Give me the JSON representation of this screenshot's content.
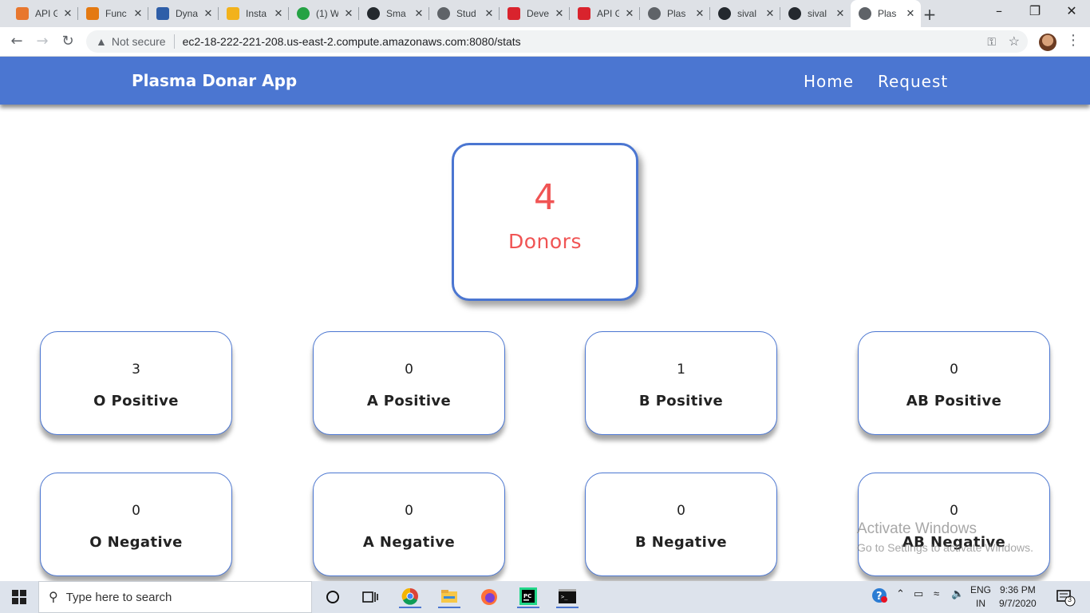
{
  "browser": {
    "tabs": [
      {
        "title": "API G",
        "icon": "aws-api-gateway-icon",
        "color": "#e8772e"
      },
      {
        "title": "Func",
        "icon": "aws-lambda-icon",
        "color": "#e47911"
      },
      {
        "title": "Dyna",
        "icon": "aws-dynamodb-icon",
        "color": "#2e5ea8"
      },
      {
        "title": "Insta",
        "icon": "aws-ec2-icon",
        "color": "#f2b21c"
      },
      {
        "title": "(1) W",
        "icon": "whatsapp-icon",
        "color": "#25a244"
      },
      {
        "title": "Sma",
        "icon": "github-icon",
        "color": "#24292e"
      },
      {
        "title": "Stud",
        "icon": "globe-icon",
        "color": "#5f6368"
      },
      {
        "title": "Deve",
        "icon": "devpost-icon",
        "color": "#d9232d"
      },
      {
        "title": "API G",
        "icon": "devpost-icon",
        "color": "#d9232d"
      },
      {
        "title": "Plas",
        "icon": "globe-icon",
        "color": "#5f6368"
      },
      {
        "title": "sival",
        "icon": "github-icon",
        "color": "#24292e"
      },
      {
        "title": "sival",
        "icon": "github-icon",
        "color": "#24292e"
      },
      {
        "title": "Plas",
        "icon": "globe-icon",
        "color": "#5f6368"
      }
    ],
    "active_tab_index": 12,
    "security_label": "Not secure",
    "url": "ec2-18-222-221-208.us-east-2.compute.amazonaws.com:8080/stats"
  },
  "app": {
    "brand": "Plasma Donar App",
    "nav": {
      "home": "Home",
      "request": "Request"
    },
    "total": {
      "count": "4",
      "label": "Donors"
    },
    "blood_groups": [
      {
        "count": "3",
        "label": "O Positive"
      },
      {
        "count": "0",
        "label": "A Positive"
      },
      {
        "count": "1",
        "label": "B Positive"
      },
      {
        "count": "0",
        "label": "AB Positive"
      },
      {
        "count": "0",
        "label": "O Negative"
      },
      {
        "count": "0",
        "label": "A Negative"
      },
      {
        "count": "0",
        "label": "B Negative"
      },
      {
        "count": "0",
        "label": "AB Negative"
      }
    ],
    "colors": {
      "primary": "#4b76d1",
      "accent": "#f05454"
    }
  },
  "watermark": {
    "line1": "Activate Windows",
    "line2": "Go to Settings to activate Windows."
  },
  "taskbar": {
    "search_placeholder": "Type here to search",
    "language": "ENG",
    "region": "IN",
    "time": "9:36 PM",
    "date": "9/7/2020",
    "notification_count": "3"
  }
}
